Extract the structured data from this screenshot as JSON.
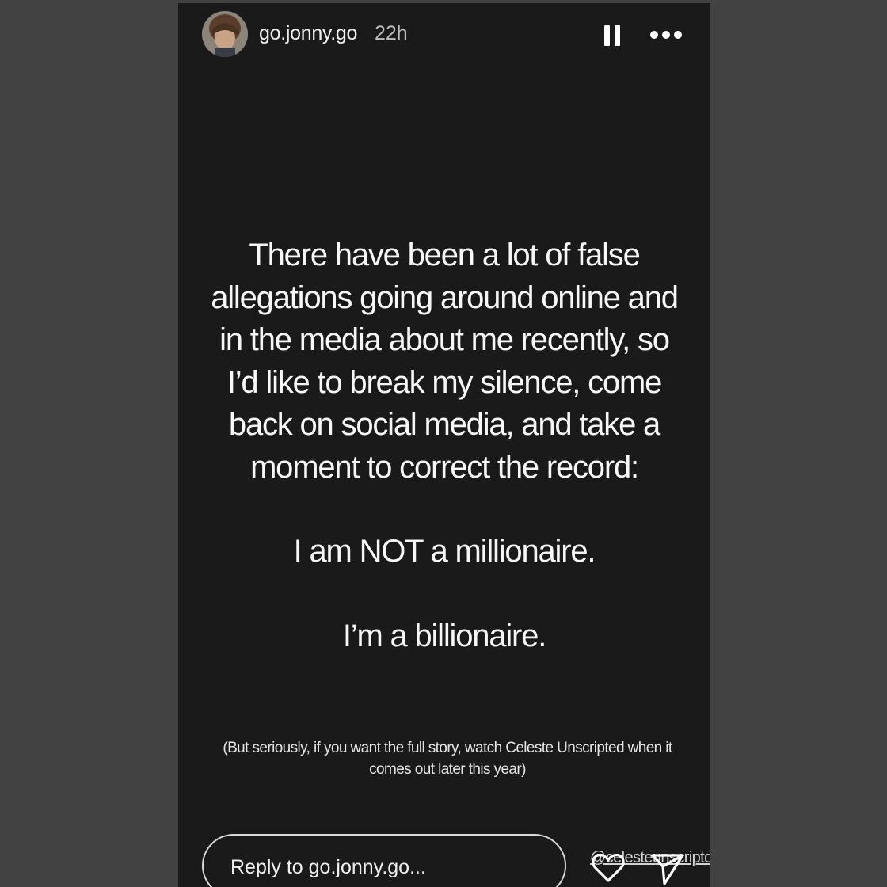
{
  "header": {
    "username": "go.jonny.go",
    "time_ago": "22h",
    "avatar_icon": "profile-photo-icon",
    "pause_icon": "pause-icon",
    "more_icon": "more-options-icon"
  },
  "story": {
    "paragraph_1": "There have been a lot of false allegations going around online and in the media about me recently, so I’d like to break my silence, come back on social media, and take a moment to correct the record:",
    "paragraph_2": "I am NOT a millionaire.",
    "paragraph_3": "I’m a billionaire.",
    "footnote": "(But seriously, if you want the full story, watch Celeste Unscripted when it comes out later this year)",
    "mention_tag": "@celesteunscriptd",
    "background_color": "#1a1a1a",
    "text_color": "#f7f7f7"
  },
  "footer": {
    "reply_placeholder": "Reply to go.jonny.go...",
    "like_icon": "heart-icon",
    "send_icon": "send-icon"
  }
}
